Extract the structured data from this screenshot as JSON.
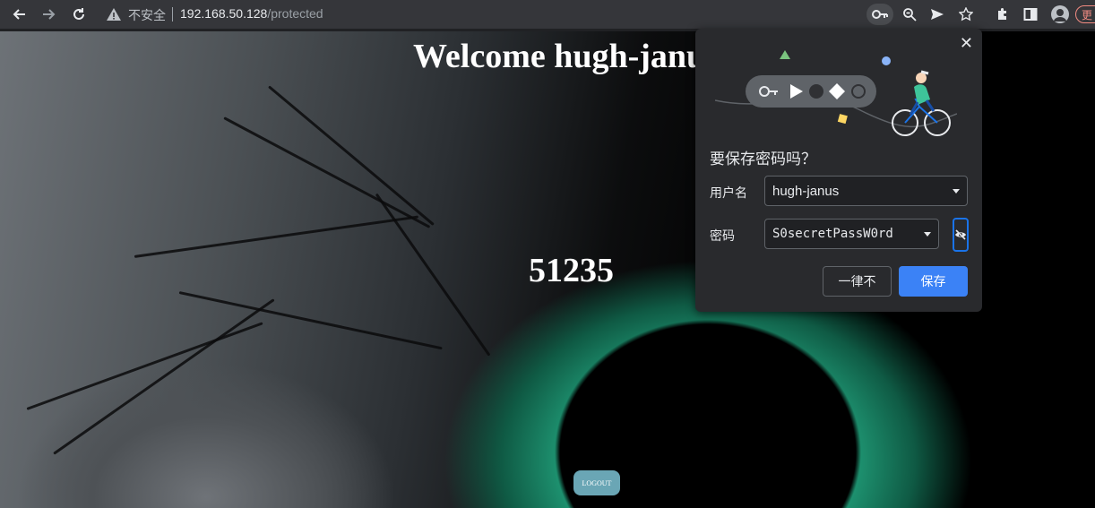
{
  "browser": {
    "security_label": "不安全",
    "url_host": "192.168.50.128",
    "url_path": "/protected",
    "update_label": "更"
  },
  "page": {
    "welcome_text": "Welcome hugh-janus",
    "code": "51235",
    "logout_label": "LOGOUT"
  },
  "password_popup": {
    "title": "要保存密码吗？",
    "username_label": "用户名",
    "username_value": "hugh-janus",
    "password_label": "密码",
    "password_value": "S0secretPassW0rd",
    "never_button": "一律不",
    "save_button": "保存",
    "close_glyph": "✕"
  },
  "colors": {
    "toolbar_bg": "#35363a",
    "popup_bg": "#292a2d",
    "save_button_bg": "#3b82f6",
    "eye_accent": "#1a73e8",
    "iris": "#1fc499"
  },
  "icons": [
    "back-icon",
    "forward-icon",
    "reload-icon",
    "warning-icon",
    "key-icon",
    "zoom-icon",
    "send-icon",
    "star-icon",
    "extensions-icon",
    "sidepanel-icon",
    "profile-icon",
    "close-icon",
    "eye-off-icon",
    "dropdown-caret-icon"
  ]
}
